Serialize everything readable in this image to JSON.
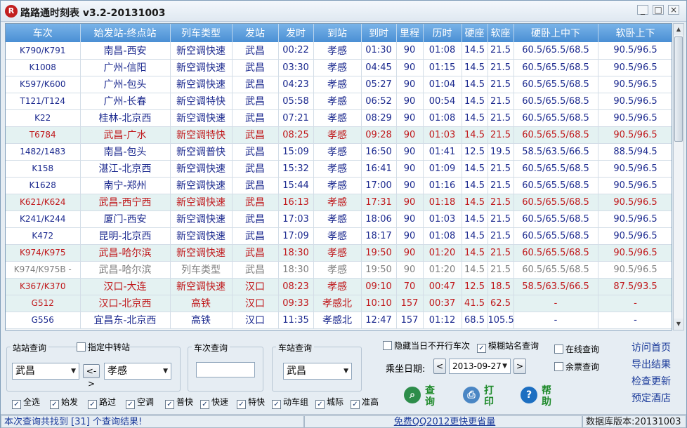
{
  "window": {
    "title": "路路通时刻表 v3.2-20131003",
    "logo_glyph": "R"
  },
  "table": {
    "headers": [
      "车次",
      "始发站-终点站",
      "列车类型",
      "发站",
      "发时",
      "到站",
      "到时",
      "里程",
      "历时",
      "硬座",
      "软座",
      "硬卧上中下",
      "软卧上下"
    ],
    "rows": [
      {
        "style": "blue",
        "c": [
          "K790/K791",
          "南昌-西安",
          "新空调快速",
          "武昌",
          "00:22",
          "孝感",
          "01:30",
          "90",
          "01:08",
          "14.5",
          "21.5",
          "60.5/65.5/68.5",
          "90.5/96.5"
        ]
      },
      {
        "style": "blue",
        "c": [
          "K1008",
          "广州-信阳",
          "新空调快速",
          "武昌",
          "03:30",
          "孝感",
          "04:45",
          "90",
          "01:15",
          "14.5",
          "21.5",
          "60.5/65.5/68.5",
          "90.5/96.5"
        ]
      },
      {
        "style": "blue",
        "c": [
          "K597/K600",
          "广州-包头",
          "新空调快速",
          "武昌",
          "04:23",
          "孝感",
          "05:27",
          "90",
          "01:04",
          "14.5",
          "21.5",
          "60.5/65.5/68.5",
          "90.5/96.5"
        ]
      },
      {
        "style": "blue",
        "c": [
          "T121/T124",
          "广州-长春",
          "新空调特快",
          "武昌",
          "05:58",
          "孝感",
          "06:52",
          "90",
          "00:54",
          "14.5",
          "21.5",
          "60.5/65.5/68.5",
          "90.5/96.5"
        ]
      },
      {
        "style": "blue",
        "c": [
          "K22",
          "桂林-北京西",
          "新空调快速",
          "武昌",
          "07:21",
          "孝感",
          "08:29",
          "90",
          "01:08",
          "14.5",
          "21.5",
          "60.5/65.5/68.5",
          "90.5/96.5"
        ]
      },
      {
        "style": "red",
        "c": [
          "T6784",
          "武昌-广水",
          "新空调特快",
          "武昌",
          "08:25",
          "孝感",
          "09:28",
          "90",
          "01:03",
          "14.5",
          "21.5",
          "60.5/65.5/68.5",
          "90.5/96.5"
        ]
      },
      {
        "style": "blue",
        "c": [
          "1482/1483",
          "南昌-包头",
          "新空调普快",
          "武昌",
          "15:09",
          "孝感",
          "16:50",
          "90",
          "01:41",
          "12.5",
          "19.5",
          "58.5/63.5/66.5",
          "88.5/94.5"
        ]
      },
      {
        "style": "blue",
        "c": [
          "K158",
          "湛江-北京西",
          "新空调快速",
          "武昌",
          "15:32",
          "孝感",
          "16:41",
          "90",
          "01:09",
          "14.5",
          "21.5",
          "60.5/65.5/68.5",
          "90.5/96.5"
        ]
      },
      {
        "style": "blue",
        "c": [
          "K1628",
          "南宁-郑州",
          "新空调快速",
          "武昌",
          "15:44",
          "孝感",
          "17:00",
          "90",
          "01:16",
          "14.5",
          "21.5",
          "60.5/65.5/68.5",
          "90.5/96.5"
        ]
      },
      {
        "style": "red",
        "c": [
          "K621/K624",
          "武昌-西宁西",
          "新空调快速",
          "武昌",
          "16:13",
          "孝感",
          "17:31",
          "90",
          "01:18",
          "14.5",
          "21.5",
          "60.5/65.5/68.5",
          "90.5/96.5"
        ]
      },
      {
        "style": "blue",
        "c": [
          "K241/K244",
          "厦门-西安",
          "新空调快速",
          "武昌",
          "17:03",
          "孝感",
          "18:06",
          "90",
          "01:03",
          "14.5",
          "21.5",
          "60.5/65.5/68.5",
          "90.5/96.5"
        ]
      },
      {
        "style": "blue",
        "c": [
          "K472",
          "昆明-北京西",
          "新空调快速",
          "武昌",
          "17:09",
          "孝感",
          "18:17",
          "90",
          "01:08",
          "14.5",
          "21.5",
          "60.5/65.5/68.5",
          "90.5/96.5"
        ]
      },
      {
        "style": "red",
        "c": [
          "K974/K975",
          "武昌-哈尔滨",
          "新空调快速",
          "武昌",
          "18:30",
          "孝感",
          "19:50",
          "90",
          "01:20",
          "14.5",
          "21.5",
          "60.5/65.5/68.5",
          "90.5/96.5"
        ]
      },
      {
        "style": "gray",
        "c": [
          "K974/K975B -",
          "武昌-哈尔滨",
          "列车类型",
          "武昌",
          "18:30",
          "孝感",
          "19:50",
          "90",
          "01:20",
          "14.5",
          "21.5",
          "60.5/65.5/68.5",
          "90.5/96.5"
        ]
      },
      {
        "style": "red",
        "c": [
          "K367/K370",
          "汉口-大连",
          "新空调快速",
          "汉口",
          "08:23",
          "孝感",
          "09:10",
          "70",
          "00:47",
          "12.5",
          "18.5",
          "58.5/63.5/66.5",
          "87.5/93.5"
        ]
      },
      {
        "style": "red",
        "c": [
          "G512",
          "汉口-北京西",
          "高铁",
          "汉口",
          "09:33",
          "孝感北",
          "10:10",
          "157",
          "00:37",
          "41.5",
          "62.5",
          "-",
          "-"
        ]
      },
      {
        "style": "blue",
        "c": [
          "G556",
          "宜昌东-北京西",
          "高铁",
          "汉口",
          "11:35",
          "孝感北",
          "12:47",
          "157",
          "01:12",
          "68.5",
          "105.5",
          "-",
          "-"
        ]
      }
    ]
  },
  "station_query": {
    "label": "站站查询",
    "via_label": "指定中转站",
    "from": "武昌",
    "swap_label": "<->",
    "to": "孝感"
  },
  "train_query": {
    "label": "车次查询",
    "value": ""
  },
  "station_only_query": {
    "label": "车站查询",
    "station": "武昌"
  },
  "filters": {
    "hide_not_running": "隐藏当日不开行车次",
    "fuzzy_station": "模糊站名查询",
    "online_query": "在线查询",
    "remaining_tickets": "余票查询",
    "date_label": "乘坐日期:",
    "date_value": "2013-09-27",
    "prev": "<",
    "next": ">"
  },
  "type_checks": [
    "全选",
    "始发",
    "路过",
    "空调",
    "普快",
    "快速",
    "特快",
    "动车组",
    "城际",
    "准高"
  ],
  "actions": {
    "query": "查询",
    "print": "打印",
    "help": "帮助"
  },
  "links": [
    "访问首页",
    "导出结果",
    "检查更新",
    "预定酒店"
  ],
  "status": {
    "result": "本次查询共找到 [31] 个查询结果!",
    "promo": "免费QQ2012更快更省量",
    "db_version": "数据库版本:20131003"
  },
  "colors": {
    "header_blue": "#4a8fd4",
    "row_blue": "#1c2a8f",
    "row_red": "#c0181b",
    "row_gray": "#808080",
    "link_blue": "#1a3a9a",
    "action_green": "#1e8a2a"
  }
}
